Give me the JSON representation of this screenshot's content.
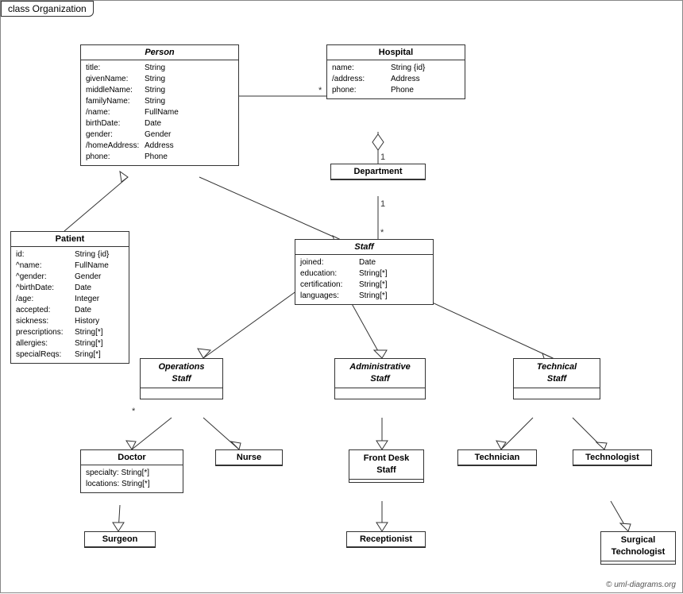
{
  "title": "class Organization",
  "copyright": "© uml-diagrams.org",
  "classes": {
    "person": {
      "name": "Person",
      "attrs": [
        {
          "name": "title:",
          "type": "String"
        },
        {
          "name": "givenName:",
          "type": "String"
        },
        {
          "name": "middleName:",
          "type": "String"
        },
        {
          "name": "familyName:",
          "type": "String"
        },
        {
          "name": "/name:",
          "type": "FullName"
        },
        {
          "name": "birthDate:",
          "type": "Date"
        },
        {
          "name": "gender:",
          "type": "Gender"
        },
        {
          "name": "/homeAddress:",
          "type": "Address"
        },
        {
          "name": "phone:",
          "type": "Phone"
        }
      ]
    },
    "hospital": {
      "name": "Hospital",
      "attrs": [
        {
          "name": "name:",
          "type": "String {id}"
        },
        {
          "name": "/address:",
          "type": "Address"
        },
        {
          "name": "phone:",
          "type": "Phone"
        }
      ]
    },
    "department": {
      "name": "Department",
      "attrs": []
    },
    "staff": {
      "name": "Staff",
      "attrs": [
        {
          "name": "joined:",
          "type": "Date"
        },
        {
          "name": "education:",
          "type": "String[*]"
        },
        {
          "name": "certification:",
          "type": "String[*]"
        },
        {
          "name": "languages:",
          "type": "String[*]"
        }
      ]
    },
    "patient": {
      "name": "Patient",
      "attrs": [
        {
          "name": "id:",
          "type": "String {id}"
        },
        {
          "name": "^name:",
          "type": "FullName"
        },
        {
          "name": "^gender:",
          "type": "Gender"
        },
        {
          "name": "^birthDate:",
          "type": "Date"
        },
        {
          "name": "/age:",
          "type": "Integer"
        },
        {
          "name": "accepted:",
          "type": "Date"
        },
        {
          "name": "sickness:",
          "type": "History"
        },
        {
          "name": "prescriptions:",
          "type": "String[*]"
        },
        {
          "name": "allergies:",
          "type": "String[*]"
        },
        {
          "name": "specialReqs:",
          "type": "Sring[*]"
        }
      ]
    },
    "operations_staff": {
      "name": "Operations\nStaff",
      "italic": true
    },
    "administrative_staff": {
      "name": "Administrative\nStaff",
      "italic": true
    },
    "technical_staff": {
      "name": "Technical\nStaff",
      "italic": true
    },
    "doctor": {
      "name": "Doctor",
      "attrs": [
        {
          "name": "specialty:",
          "type": "String[*]"
        },
        {
          "name": "locations:",
          "type": "String[*]"
        }
      ]
    },
    "nurse": {
      "name": "Nurse",
      "attrs": []
    },
    "front_desk_staff": {
      "name": "Front Desk\nStaff",
      "attrs": []
    },
    "technician": {
      "name": "Technician",
      "attrs": []
    },
    "technologist": {
      "name": "Technologist",
      "attrs": []
    },
    "surgeon": {
      "name": "Surgeon",
      "attrs": []
    },
    "receptionist": {
      "name": "Receptionist",
      "attrs": []
    },
    "surgical_technologist": {
      "name": "Surgical\nTechnologist",
      "attrs": []
    }
  },
  "multiplicity": {
    "star": "*",
    "one": "1"
  }
}
